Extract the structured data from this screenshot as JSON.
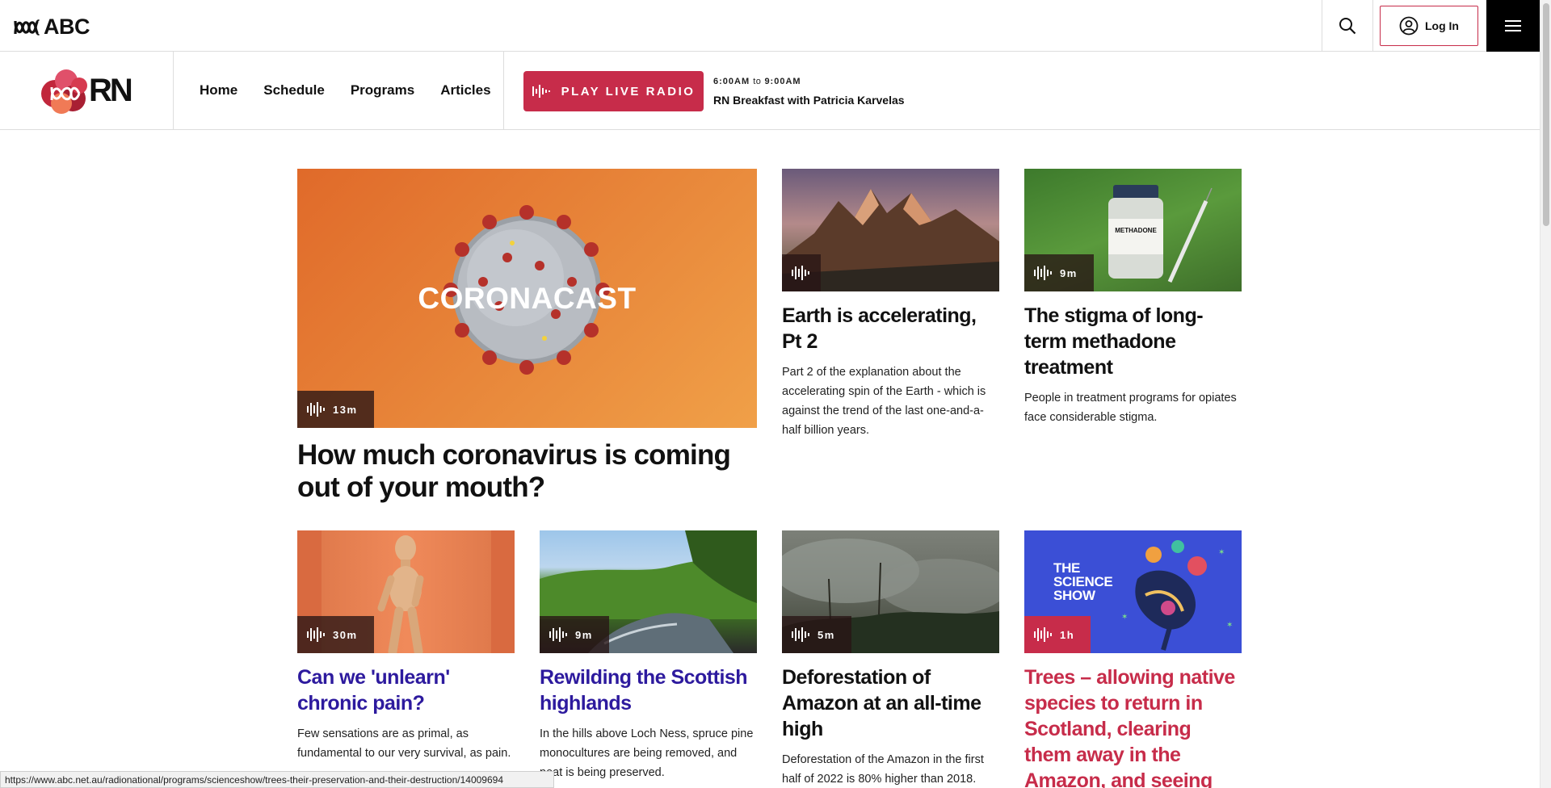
{
  "abc": {
    "logo_text": "ABC",
    "login_label": "Log In"
  },
  "rn": {
    "logo_text": "RN",
    "nav": [
      "Home",
      "Schedule",
      "Programs",
      "Articles"
    ],
    "live_label": "PLAY LIVE RADIO",
    "now_start": "6:00AM",
    "now_to": "to",
    "now_end": "9:00AM",
    "now_show": "RN Breakfast with Patricia Karvelas"
  },
  "featured": {
    "overlay_title": "CORONACAST",
    "duration": "13m",
    "title": "How much coronavirus is coming out of your mouth?"
  },
  "top_cards": [
    {
      "title": "Earth is accelerating, Pt 2",
      "duration": "",
      "desc": "Part 2 of the explanation about the accelerating spin of the Earth - which is against the trend of the last one-and-a-half billion years."
    },
    {
      "title": "The stigma of long-term methadone treatment",
      "duration": "9m",
      "desc": "People in treatment programs for opiates face considerable stigma.",
      "vial_label": "METHADONE"
    }
  ],
  "bottom_cards": [
    {
      "title": "Can we 'unlearn' chronic pain?",
      "duration": "30m",
      "desc": "Few sensations are as primal, as fundamental to our very survival, as pain."
    },
    {
      "title": "Rewilding the Scottish highlands",
      "duration": "9m",
      "desc": "In the hills above Loch Ness, spruce pine monocultures are being removed, and peat is being preserved."
    },
    {
      "title": "Deforestation of Amazon at an all-time high",
      "duration": "5m",
      "desc": "Deforestation of the Amazon in the first half of 2022 is 80% higher than 2018."
    },
    {
      "title": "Trees – allowing native species to return in Scotland, clearing them away in the Amazon, and seeing how they",
      "duration": "1h",
      "thumb_text": "THE SCIENCE SHOW"
    }
  ],
  "colors": {
    "accent_red": "#c72c4a",
    "visited_purple": "#2d1a9e"
  },
  "status_url": "https://www.abc.net.au/radionational/programs/scienceshow/trees-their-preservation-and-their-destruction/14009694"
}
